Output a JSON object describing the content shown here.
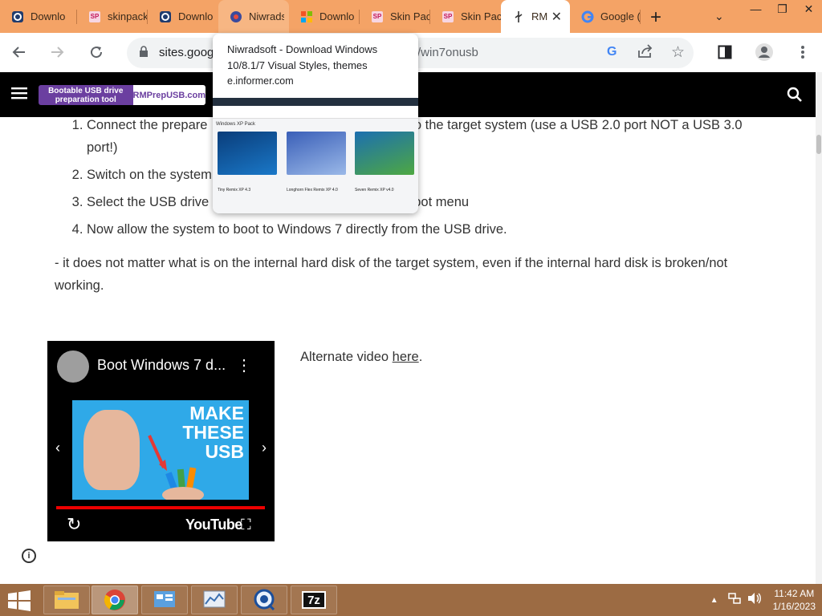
{
  "browser": {
    "tabs": [
      {
        "title": "Downloa",
        "favicon": "informer-icon"
      },
      {
        "title": "skinpack",
        "favicon": "sp-icon"
      },
      {
        "title": "Downloa",
        "favicon": "informer-icon"
      },
      {
        "title": "Niwradsc",
        "favicon": "niwradsoft-icon"
      },
      {
        "title": "Downloa",
        "favicon": "windows-icon"
      },
      {
        "title": "Skin Pac",
        "favicon": "sp-icon"
      },
      {
        "title": "Skin Pac",
        "favicon": "sp-icon"
      },
      {
        "title": "RM",
        "favicon": "usb-icon"
      },
      {
        "title": "Google (",
        "favicon": "google-icon"
      }
    ],
    "url_visible": "sites.goog",
    "url_tail": "/win7onusb",
    "hovercard": {
      "title": "Niwradsoft - Download Windows 10/8.1/7 Visual Styles, themes",
      "domain": "e.informer.com",
      "preview_crumb": "Windows XP Pack",
      "preview_items": [
        "Tiny Remix XP 4.3",
        "Longhorn Flex Remix XP 4.0",
        "Seven Remix XP v4.0"
      ]
    }
  },
  "site": {
    "banner_left": "Bootable USB drive preparation tool",
    "banner_right": "RMPrepUSB.com"
  },
  "content": {
    "steps": [
      {
        "pre": "Connect the prepare",
        "post": "r Flash drive) to the target system (use a USB 2.0 port NOT a USB 3.0 port!)"
      },
      {
        "pre": "Switch on the system",
        "post": ""
      },
      {
        "pre": "Select the USB drive",
        "post": "oot menu"
      },
      {
        "pre": "Now allow the system to boot to Windows 7 directly from the USB drive.",
        "post": ""
      }
    ],
    "paragraph": "- it does not matter what is on the internal hard disk of the target system, even if the internal hard disk is broken/not working.",
    "alt_video_prefix": "Alternate video ",
    "alt_video_link": "here",
    "alt_video_suffix": ".",
    "video": {
      "title": "Boot Windows 7 d...",
      "thumb_text": "MAKE THESE USB",
      "brand": "YouTube"
    }
  },
  "taskbar": {
    "apps": [
      "explorer",
      "chrome",
      "control-panel",
      "resource-monitor",
      "magnifier",
      "7zip"
    ],
    "active": "chrome",
    "time": "11:42 AM",
    "date": "1/16/2023"
  }
}
